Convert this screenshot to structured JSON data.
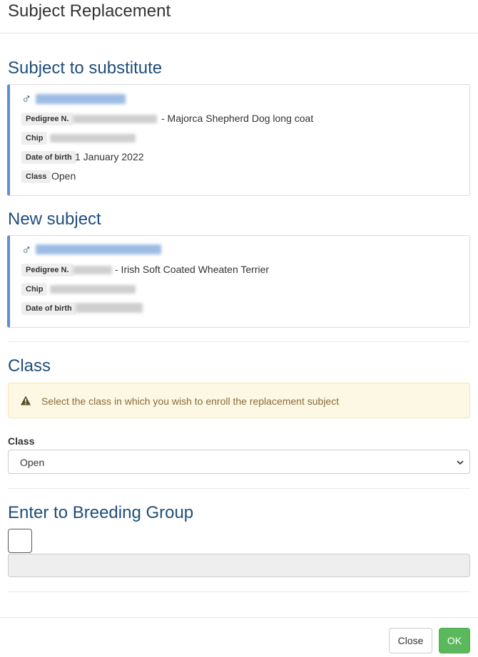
{
  "modal": {
    "title": "Subject Replacement"
  },
  "subject_to_substitute": {
    "heading": "Subject to substitute",
    "gender_symbol": "♂",
    "name": "[redacted]",
    "pedigree_label": "Pedigree N.",
    "pedigree_suffix": "- Majorca Shepherd Dog long coat",
    "chip_label": "Chip",
    "dob_label": "Date of birth",
    "dob_value": "1 January 2022",
    "class_label": "Class",
    "class_value": "Open"
  },
  "new_subject": {
    "heading": "New subject",
    "gender_symbol": "♂",
    "name": "[redacted]",
    "pedigree_label": "Pedigree N.",
    "pedigree_suffix": "- Irish Soft Coated Wheaten Terrier",
    "chip_label": "Chip",
    "dob_label": "Date of birth"
  },
  "class_section": {
    "heading": "Class",
    "alert_text": "Select the class in which you wish to enroll the replacement subject",
    "field_label": "Class",
    "selected": "Open"
  },
  "breeding_group": {
    "heading": "Enter to Breeding Group",
    "checked": false,
    "input_value": ""
  },
  "footer": {
    "close_label": "Close",
    "ok_label": "OK"
  },
  "icons": {
    "alert": "warning-icon",
    "gender": "male-icon",
    "select": "chevron-down-icon"
  },
  "colors": {
    "heading": "#1f4e79",
    "card_accent": "#5b8fd6",
    "alert_bg": "#fcf8e3",
    "alert_text": "#8a6d3b",
    "ok_button": "#5cb85c"
  }
}
